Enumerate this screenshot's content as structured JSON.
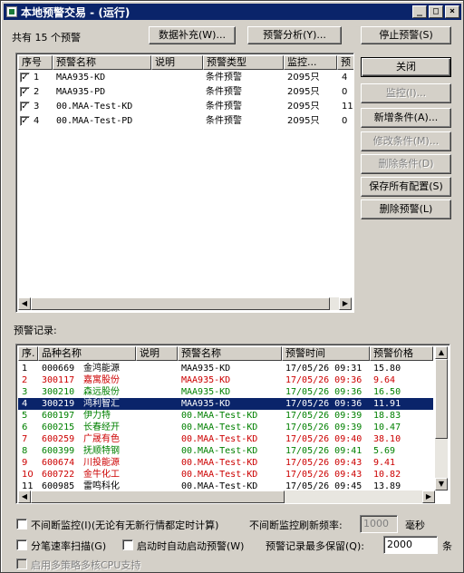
{
  "window": {
    "title": "本地预警交易 - (运行)",
    "controls": [
      "_",
      "□",
      "×"
    ]
  },
  "top": {
    "count_label": "共有 15 个预警",
    "supplement_btn": "数据补充(W)...",
    "analyze_btn": "预警分析(Y)...",
    "stop_btn": "停止预警(S)"
  },
  "alerts_table": {
    "headers": [
      "序号",
      "预警名称",
      "说明",
      "预警类型",
      "监控...",
      "预"
    ],
    "rows": [
      {
        "checked": true,
        "num": "1",
        "name": "MAA935-KD",
        "desc": "",
        "type": "条件预警",
        "monitor": "2095只",
        "extra": "4"
      },
      {
        "checked": true,
        "num": "2",
        "name": "MAA935-PD",
        "desc": "",
        "type": "条件预警",
        "monitor": "2095只",
        "extra": "0"
      },
      {
        "checked": true,
        "num": "3",
        "name": "00.MAA-Test-KD",
        "desc": "",
        "type": "条件预警",
        "monitor": "2095只",
        "extra": "11"
      },
      {
        "checked": true,
        "num": "4",
        "name": "00.MAA-Test-PD",
        "desc": "",
        "type": "条件预警",
        "monitor": "2095只",
        "extra": "0"
      }
    ]
  },
  "side_buttons": {
    "close": "关闭",
    "monitor": "监控(I)...",
    "add": "新增条件(A)...",
    "modify": "修改条件(M)...",
    "delete_cond": "删除条件(D)",
    "save": "保存所有配置(S)",
    "delete_alert": "删除预警(L)"
  },
  "records": {
    "label": "预警记录:",
    "headers": [
      "序.",
      "品种名称",
      "说明",
      "预警名称",
      "预警时间",
      "预警价格"
    ],
    "rows": [
      {
        "num": "1",
        "code": "000669",
        "name": "金鸿能源",
        "desc": "",
        "alert": "MAA935-KD",
        "time": "17/05/26 09:31",
        "price": "15.80",
        "color": "#000000"
      },
      {
        "num": "2",
        "code": "300117",
        "name": "嘉寓股份",
        "desc": "",
        "alert": "MAA935-KD",
        "time": "17/05/26 09:36",
        "price": "9.64",
        "color": "#cc0000"
      },
      {
        "num": "3",
        "code": "300210",
        "name": "森远股份",
        "desc": "",
        "alert": "MAA935-KD",
        "time": "17/05/26 09:36",
        "price": "16.50",
        "color": "#008000"
      },
      {
        "num": "4",
        "code": "300219",
        "name": "鸿利智汇",
        "desc": "",
        "alert": "MAA935-KD",
        "time": "17/05/26 09:36",
        "price": "11.91",
        "color": "#ffffff"
      },
      {
        "num": "5",
        "code": "600197",
        "name": "伊力特",
        "desc": "",
        "alert": "00.MAA-Test-KD",
        "time": "17/05/26 09:39",
        "price": "18.83",
        "color": "#008000"
      },
      {
        "num": "6",
        "code": "600215",
        "name": "长春经开",
        "desc": "",
        "alert": "00.MAA-Test-KD",
        "time": "17/05/26 09:39",
        "price": "10.47",
        "color": "#008000"
      },
      {
        "num": "7",
        "code": "600259",
        "name": "广晟有色",
        "desc": "",
        "alert": "00.MAA-Test-KD",
        "time": "17/05/26 09:40",
        "price": "38.10",
        "color": "#cc0000"
      },
      {
        "num": "8",
        "code": "600399",
        "name": "抚顺特钢",
        "desc": "",
        "alert": "00.MAA-Test-KD",
        "time": "17/05/26 09:41",
        "price": "5.69",
        "color": "#008000"
      },
      {
        "num": "9",
        "code": "600674",
        "name": "川投能源",
        "desc": "",
        "alert": "00.MAA-Test-KD",
        "time": "17/05/26 09:43",
        "price": "9.41",
        "color": "#cc0000"
      },
      {
        "num": "10",
        "code": "600722",
        "name": "金牛化工",
        "desc": "",
        "alert": "00.MAA-Test-KD",
        "time": "17/05/26 09:43",
        "price": "10.82",
        "color": "#cc0000"
      },
      {
        "num": "11",
        "code": "600985",
        "name": "雷鸣科化",
        "desc": "",
        "alert": "00.MAA-Test-KD",
        "time": "17/05/26 09:45",
        "price": "13.89",
        "color": "#000000"
      }
    ]
  },
  "options": {
    "continuous": "不间断监控(I)(无论有无新行情都定时计算)",
    "refresh_label": "不间断监控刷新频率:",
    "refresh_value": "1000",
    "refresh_unit": "毫秒",
    "tick_scan": "分笔速率扫描(G)",
    "auto_start": "启动时自动启动预警(W)",
    "max_keep_label": "预警记录最多保留(Q):",
    "max_keep_value": "2000",
    "max_keep_unit": "条",
    "multi_cpu": "启用多策略多核CPU支持"
  }
}
